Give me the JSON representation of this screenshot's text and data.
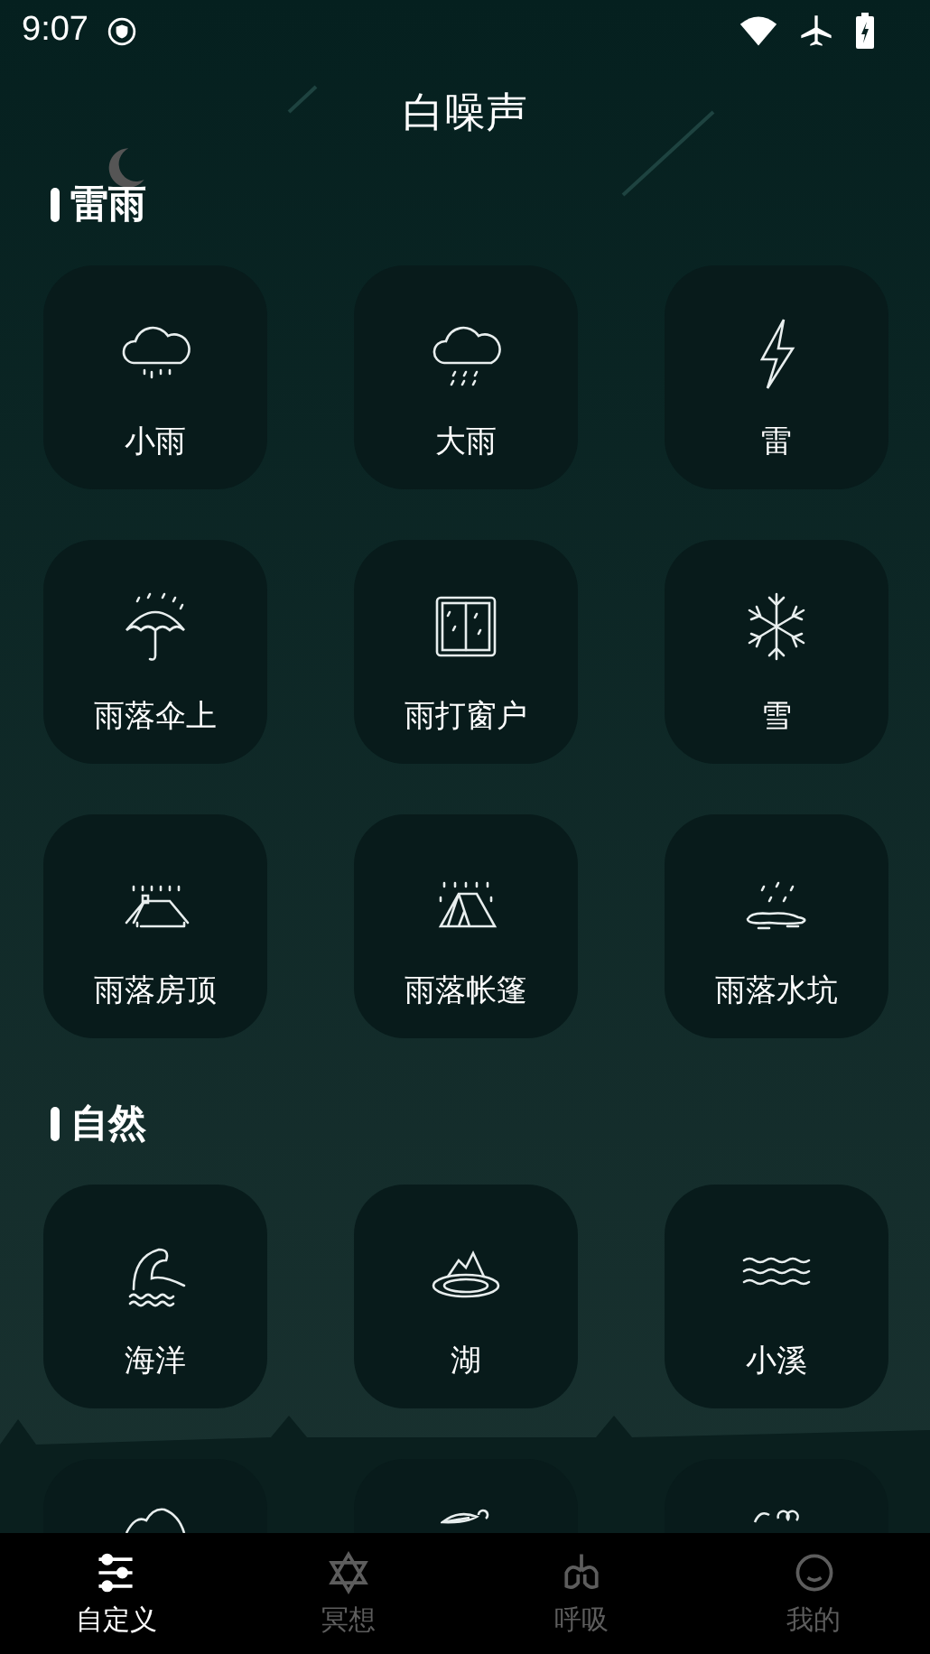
{
  "status_bar": {
    "time": "9:07"
  },
  "title": "白噪声",
  "sections": [
    {
      "title": "雷雨",
      "items": [
        {
          "kind": "light-rain",
          "label": "小雨"
        },
        {
          "kind": "heavy-rain",
          "label": "大雨"
        },
        {
          "kind": "thunder",
          "label": "雷"
        },
        {
          "kind": "umbrella",
          "label": "雨落伞上"
        },
        {
          "kind": "window",
          "label": "雨打窗户"
        },
        {
          "kind": "snow",
          "label": "雪"
        },
        {
          "kind": "roof",
          "label": "雨落房顶"
        },
        {
          "kind": "tent",
          "label": "雨落帐篷"
        },
        {
          "kind": "puddle",
          "label": "雨落水坑"
        }
      ]
    },
    {
      "title": "自然",
      "items": [
        {
          "kind": "ocean",
          "label": "海洋"
        },
        {
          "kind": "lake",
          "label": "湖"
        },
        {
          "kind": "stream",
          "label": "小溪"
        },
        {
          "kind": "hill"
        },
        {
          "kind": "leaf"
        },
        {
          "kind": "wind"
        }
      ]
    }
  ],
  "tabs": [
    {
      "kind": "sliders",
      "label": "自定义",
      "selected": true
    },
    {
      "kind": "star",
      "label": "冥想",
      "selected": false
    },
    {
      "kind": "breath",
      "label": "呼吸",
      "selected": false
    },
    {
      "kind": "face",
      "label": "我的",
      "selected": false
    }
  ]
}
